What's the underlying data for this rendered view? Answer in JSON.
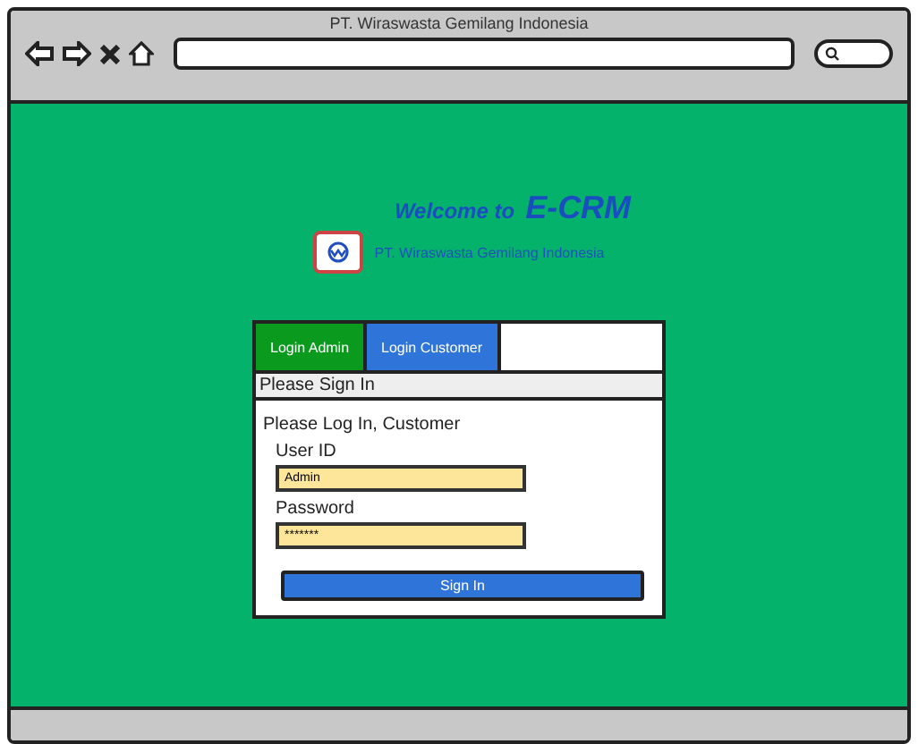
{
  "window": {
    "title": "PT. Wiraswasta Gemilang Indonesia"
  },
  "header": {
    "welcome": "Welcome to",
    "brand": "E-CRM",
    "subtitle": "PT. Wiraswasta Gemilang Indonesia"
  },
  "tabs": [
    {
      "label": "Login Admin",
      "color": "#0a9a1e"
    },
    {
      "label": "Login Customer",
      "color": "#2f74d8"
    }
  ],
  "panel": {
    "title": "Please Sign In",
    "prompt": "Please Log In, Customer",
    "fields": [
      {
        "label": "User ID",
        "value": "Admin"
      },
      {
        "label": "Password",
        "value": "*******"
      }
    ],
    "button": "Sign In"
  }
}
